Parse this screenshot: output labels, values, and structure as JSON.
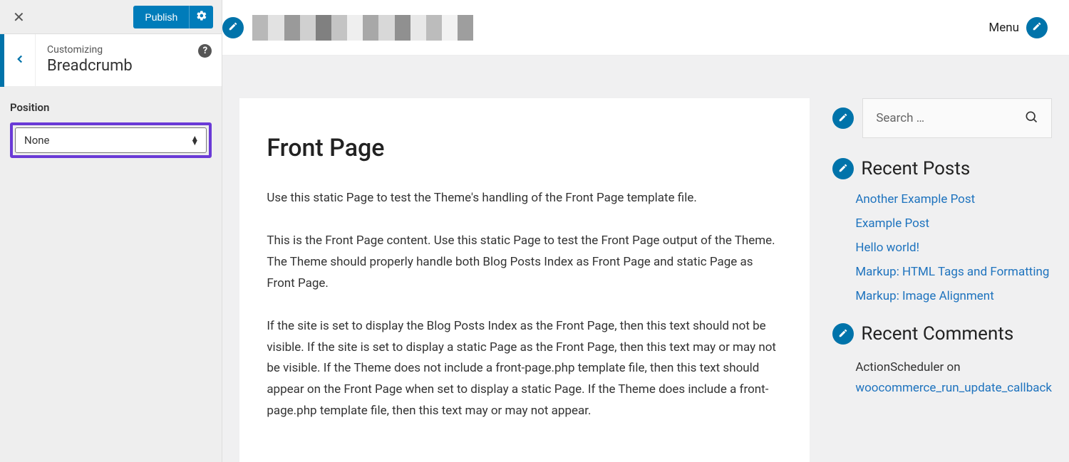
{
  "sidebar": {
    "publish_label": "Publish",
    "customizing_label": "Customizing",
    "section_title": "Breadcrumb",
    "help_symbol": "?"
  },
  "position_field": {
    "label": "Position",
    "selected": "None"
  },
  "header": {
    "menu_label": "Menu"
  },
  "page": {
    "title": "Front Page",
    "p1": "Use this static Page to test the Theme's handling of the Front Page template file.",
    "p2": "This is the Front Page content. Use this static Page to test the Front Page output of the Theme. The Theme should properly handle both Blog Posts Index as Front Page and static Page as Front Page.",
    "p3": "If the site is set to display the Blog Posts Index as the Front Page, then this text should not be visible. If the site is set to display a static Page as the Front Page, then this text may or may not be visible. If the Theme does not include a front-page.php template file, then this text should appear on the Front Page when set to display a static Page. If the Theme does include a front-page.php template file, then this text may or may not appear."
  },
  "search": {
    "placeholder": "Search …"
  },
  "recent_posts": {
    "title": "Recent Posts",
    "items": [
      "Another Example Post",
      "Example Post",
      "Hello world!",
      "Markup: HTML Tags and Formatting",
      "Markup: Image Alignment"
    ]
  },
  "recent_comments": {
    "title": "Recent Comments",
    "item_prefix": "ActionScheduler on ",
    "item_link": "woocommerce_run_update_callback"
  }
}
